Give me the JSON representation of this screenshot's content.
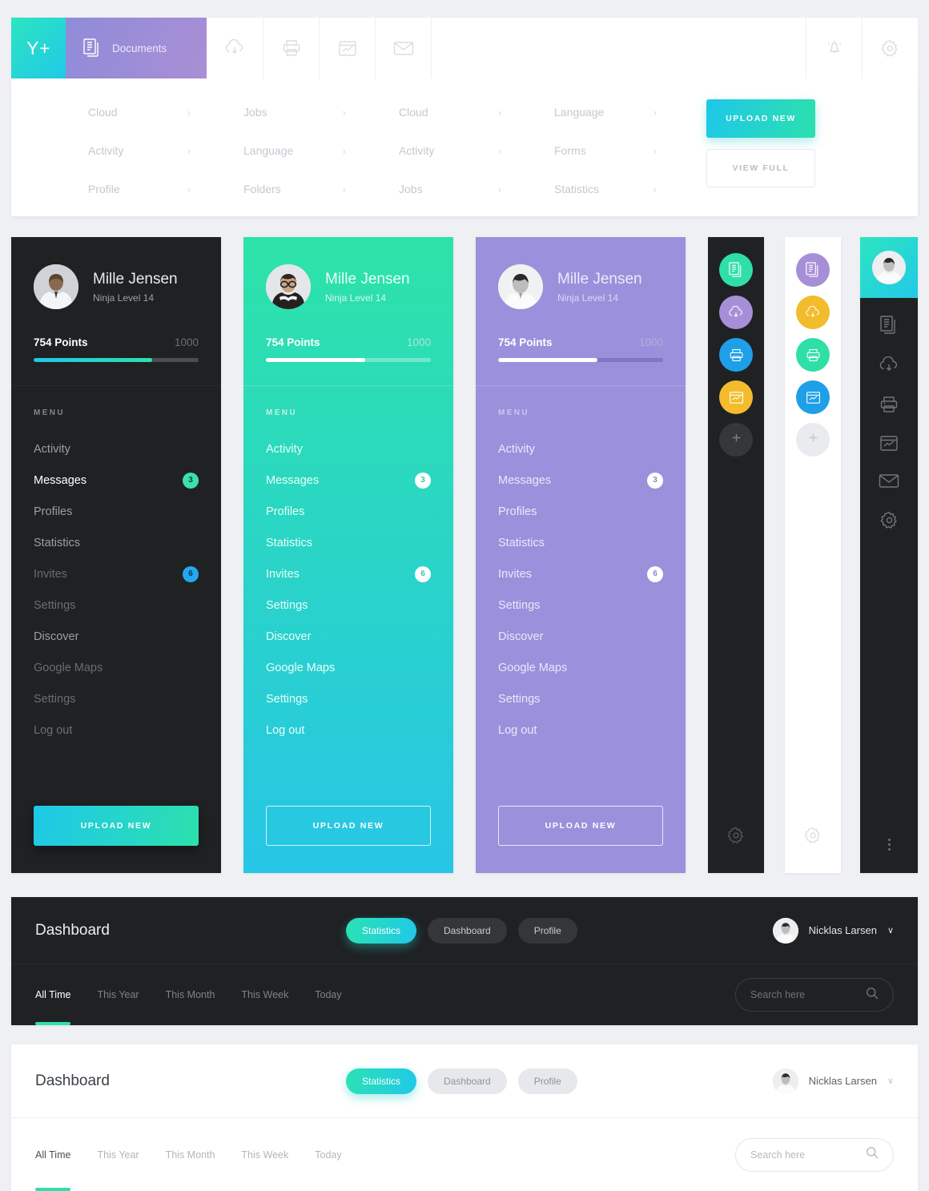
{
  "topbar": {
    "logo": "Y+",
    "documents_label": "Documents",
    "icons": [
      "documents-icon",
      "cloud-upload-icon",
      "printer-icon",
      "chart-window-icon",
      "envelope-icon"
    ],
    "right_icons": [
      "bell-icon",
      "gear-icon"
    ]
  },
  "megamenu": {
    "columns": [
      {
        "items": [
          "Cloud",
          "Activity",
          "Profile"
        ]
      },
      {
        "items": [
          "Jobs",
          "Language",
          "Folders"
        ]
      },
      {
        "items": [
          "Cloud",
          "Activity",
          "Jobs"
        ]
      },
      {
        "items": [
          "Language",
          "Forms",
          "Statistics"
        ]
      }
    ],
    "chevron": "›",
    "upload_label": "UPLOAD NEW",
    "viewfull_label": "VIEW FULL"
  },
  "profile": {
    "name": "Mille Jensen",
    "role": "Ninja Level 14",
    "points_label": "754 Points",
    "points_max": "1000",
    "progress_percent": 72,
    "menu_title": "MENU",
    "upload_label": "UPLOAD NEW",
    "menu": [
      {
        "label": "Activity",
        "badge": null
      },
      {
        "label": "Messages",
        "badge": "3",
        "badge_color": "green",
        "active": true
      },
      {
        "label": "Profiles",
        "badge": null
      },
      {
        "label": "Statistics",
        "badge": null
      },
      {
        "label": "Invites",
        "badge": "6",
        "badge_color": "blue"
      },
      {
        "label": "Settings",
        "badge": null
      },
      {
        "label": "Discover",
        "badge": null
      },
      {
        "label": "Google Maps",
        "badge": null
      },
      {
        "label": "Settings",
        "badge": null
      },
      {
        "label": "Log out",
        "badge": null,
        "dim": true
      }
    ]
  },
  "colors": {
    "accent_teal": "#2ce0ae",
    "accent_cyan": "#21c9e8",
    "purple_card": "#9a91dc",
    "dark_card": "#1f2123",
    "badge_green": "#3ce0a8",
    "badge_blue": "#23a8ef",
    "fab_purple": "#a78fd8",
    "fab_yellow": "#f2bc2c",
    "fab_green": "#2fdfa6",
    "fab_blue": "#1f9fe8",
    "page_bg": "#eef0f4"
  },
  "rail_dark": {
    "fabs": [
      {
        "icon": "documents-icon",
        "color": "#2fdfa6"
      },
      {
        "icon": "cloud-upload-icon",
        "color": "#a78fd8"
      },
      {
        "icon": "printer-icon",
        "color": "#1f9fe8"
      },
      {
        "icon": "chart-window-icon",
        "color": "#f2bc2c"
      },
      {
        "icon": "plus-icon",
        "color": "#35373a"
      }
    ],
    "gear_icon": "gear-icon"
  },
  "rail_light": {
    "fabs": [
      {
        "icon": "documents-icon",
        "color": "#a78fd8"
      },
      {
        "icon": "cloud-upload-icon",
        "color": "#f2bc2c"
      },
      {
        "icon": "printer-icon",
        "color": "#2fdfa6"
      },
      {
        "icon": "chart-window-icon",
        "color": "#1f9fe8"
      },
      {
        "icon": "plus-icon",
        "color": "#e9ebee"
      }
    ],
    "gear_icon": "gear-icon"
  },
  "slim_sidebar": {
    "icons": [
      "documents-icon",
      "cloud-upload-icon",
      "printer-icon",
      "chart-window-icon",
      "envelope-icon",
      "gear-icon"
    ],
    "more_icon": "more-vertical-icon"
  },
  "dashboard": {
    "title": "Dashboard",
    "pills": [
      {
        "label": "Statistics",
        "active": true
      },
      {
        "label": "Dashboard",
        "active": false
      },
      {
        "label": "Profile",
        "active": false
      }
    ],
    "user_name": "Nicklas Larsen",
    "chevron": "∨",
    "tabs": [
      {
        "label": "All Time",
        "active": true
      },
      {
        "label": "This Year",
        "active": false
      },
      {
        "label": "This Month",
        "active": false
      },
      {
        "label": "This Week",
        "active": false
      },
      {
        "label": "Today",
        "active": false
      }
    ],
    "search_placeholder": "Search here",
    "search_icon": "search-icon"
  }
}
